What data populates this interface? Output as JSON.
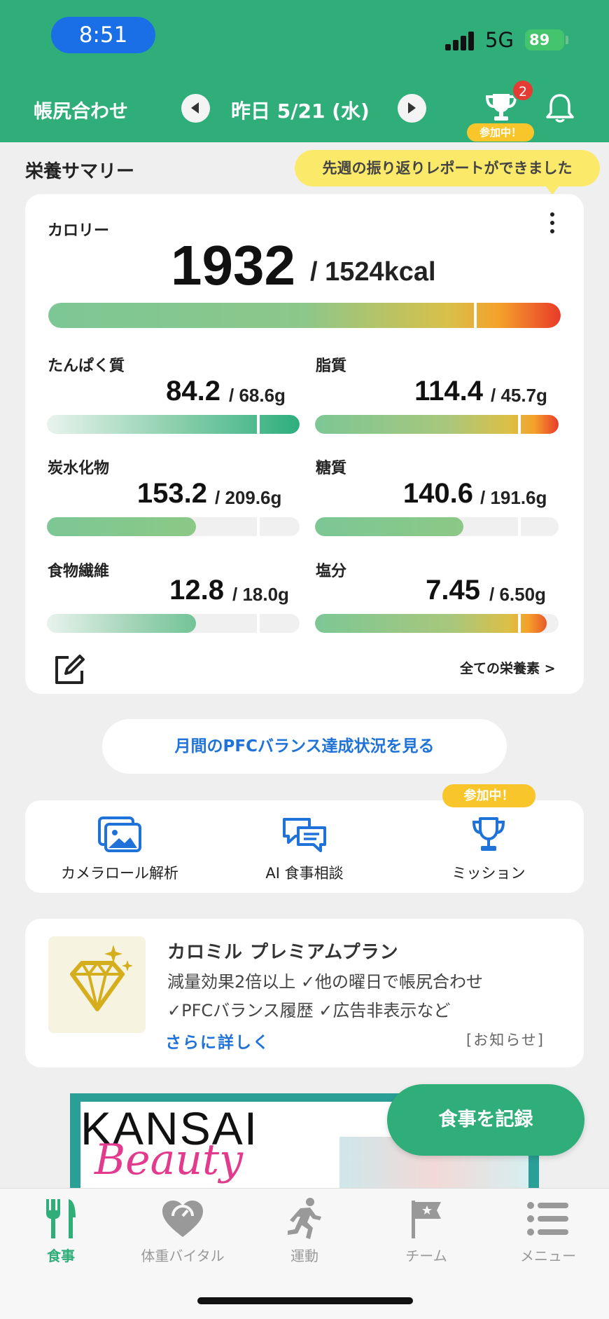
{
  "status_bar": {
    "time": "8:51",
    "network": "5G",
    "battery": "89"
  },
  "header": {
    "title": "帳尻合わせ",
    "date": "昨日 5/21 (水)",
    "notification_count": "2",
    "joining_badge": "参加中！"
  },
  "summary": {
    "section_title": "栄養サマリー",
    "tooltip": "先週の振り返りレポートができました",
    "calorie": {
      "label": "カロリー",
      "value": "1932",
      "target": "/ 1524kcal"
    },
    "nutrients": [
      {
        "label": "たんぱく質",
        "value": "84.2",
        "target": "/ 68.6g"
      },
      {
        "label": "脂質",
        "value": "114.4",
        "target": "/ 45.7g"
      },
      {
        "label": "炭水化物",
        "value": "153.2",
        "target": "/ 209.6g"
      },
      {
        "label": "糖質",
        "value": "140.6",
        "target": "/ 191.6g"
      },
      {
        "label": "食物繊維",
        "value": "12.8",
        "target": "/ 18.0g"
      },
      {
        "label": "塩分",
        "value": "7.45",
        "target": "/ 6.50g"
      }
    ],
    "all_nutrients_link": "全ての栄養素 >"
  },
  "pfc_button": "月間のPFCバランス達成状況を見る",
  "quick_actions": {
    "camera": "カメラロール解析",
    "ai": "AI 食事相談",
    "mission": "ミッション",
    "mission_badge": "参加中！"
  },
  "premium": {
    "title": "カロミル プレミアムプラン",
    "line1": "減量効果2倍以上 ✓他の曜日で帳尻合わせ",
    "line2": "✓PFCバランス履歴 ✓広告非表示など",
    "more": "さらに詳しく",
    "notice": "[お知らせ]"
  },
  "ad": {
    "text1": "KANSAI",
    "text2": "Beauty"
  },
  "fab": "食事を記録",
  "tabs": [
    {
      "label": "食事",
      "icon": "fork-knife-icon"
    },
    {
      "label": "体重バイタル",
      "icon": "heart-scale-icon"
    },
    {
      "label": "運動",
      "icon": "running-icon"
    },
    {
      "label": "チーム",
      "icon": "flag-icon"
    },
    {
      "label": "メニュー",
      "icon": "menu-list-icon"
    }
  ],
  "colors": {
    "brand": "#2fae7a",
    "link": "#1f73d8",
    "badge": "#e53b35",
    "joining": "#f8c62a"
  }
}
